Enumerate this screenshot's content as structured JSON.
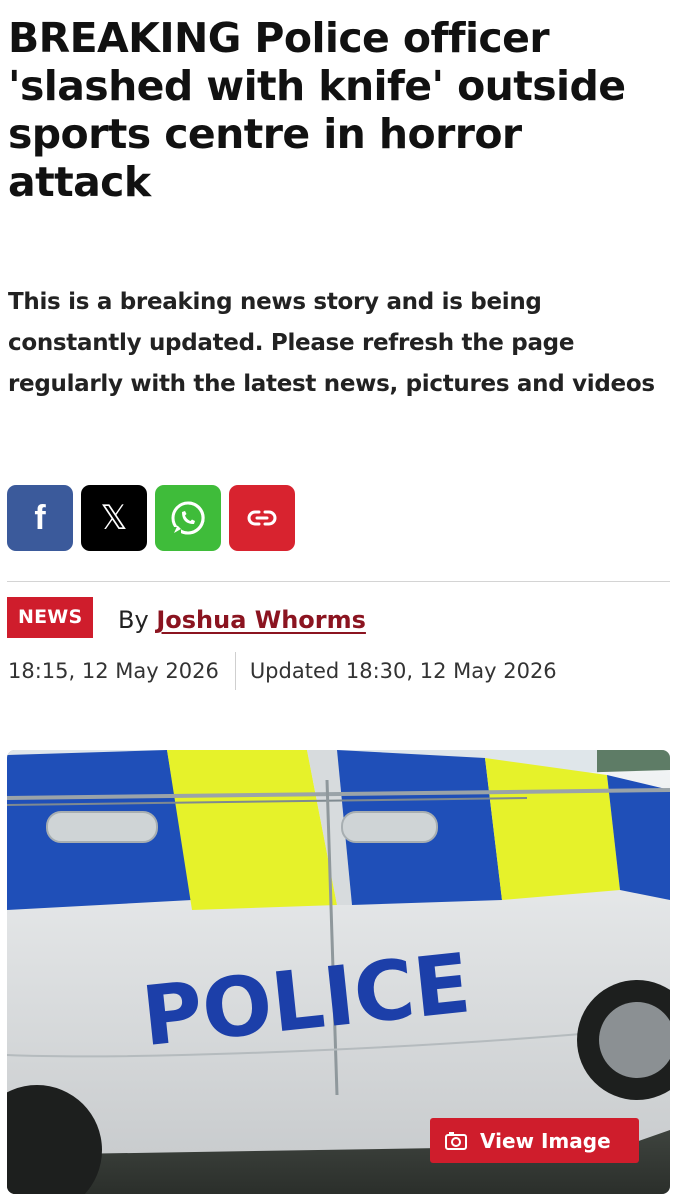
{
  "article": {
    "headline": "BREAKING Police officer 'slashed with knife' outside sports centre in horror attack",
    "standfirst": "This is a breaking news story and is being constantly updated. Please refresh the page regularly with the latest news, pictures and videos"
  },
  "share": {
    "buttons": [
      {
        "icon": "facebook-icon",
        "color": "#3b5a9b"
      },
      {
        "icon": "x-icon",
        "color": "#000000"
      },
      {
        "icon": "whatsapp-icon",
        "color": "#3fbc3a"
      },
      {
        "icon": "link-icon",
        "color": "#d8232f"
      }
    ]
  },
  "meta": {
    "section": "NEWS",
    "by_prefix": "By",
    "author": "Joshua Whorms",
    "published": "18:15, 12 May 2026",
    "updated": "Updated 18:30, 12 May 2026"
  },
  "hero": {
    "vehicle_text": "POLICE",
    "view_label": "View Image"
  },
  "colors": {
    "accent": "#cf1d2c",
    "author_link": "#8b1420",
    "police_blue": "#1f4fb8",
    "police_yellow": "#e6f22a"
  }
}
